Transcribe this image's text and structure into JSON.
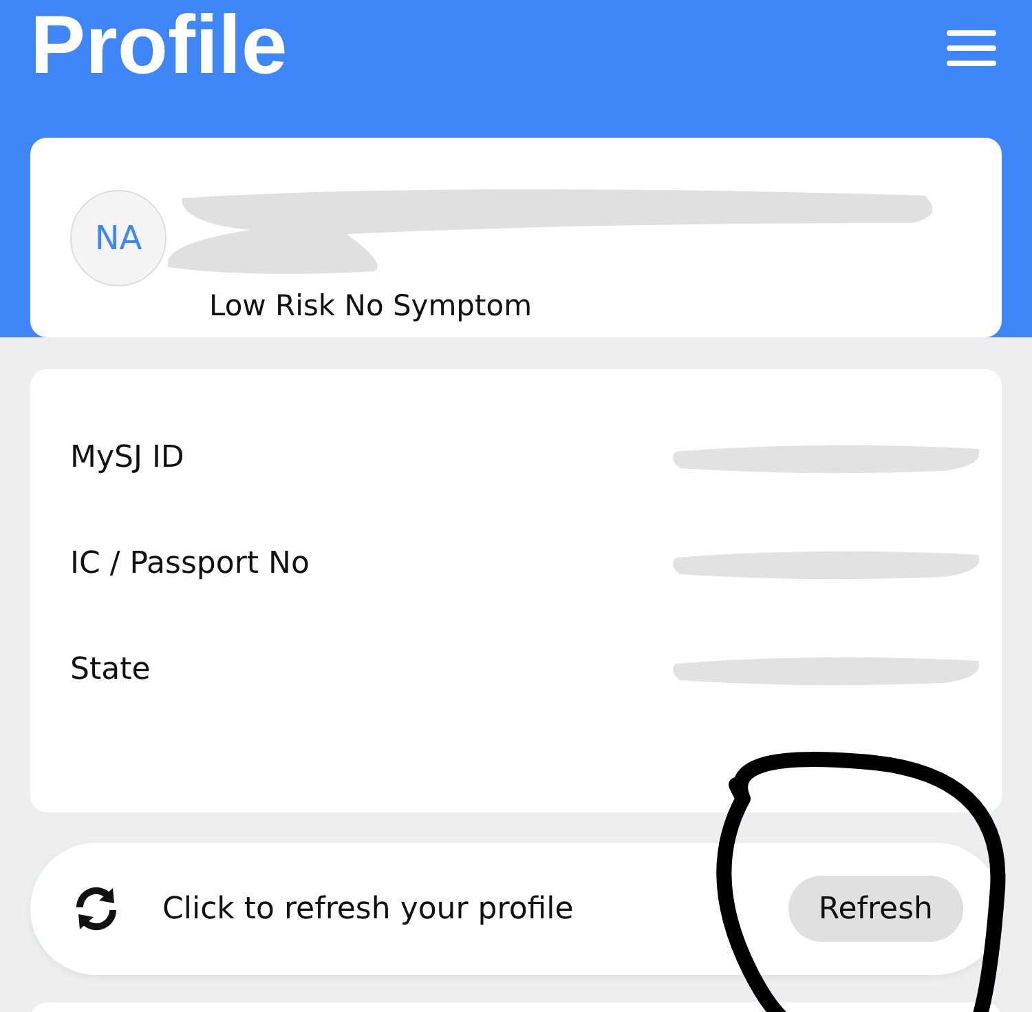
{
  "header": {
    "title": "Profile"
  },
  "profile": {
    "initials": "NA",
    "status": "Low Risk No Symptom"
  },
  "details": [
    {
      "label": "MySJ ID"
    },
    {
      "label": "IC / Passport No"
    },
    {
      "label": "State"
    }
  ],
  "refresh": {
    "message": "Click to refresh your profile",
    "button": "Refresh"
  }
}
